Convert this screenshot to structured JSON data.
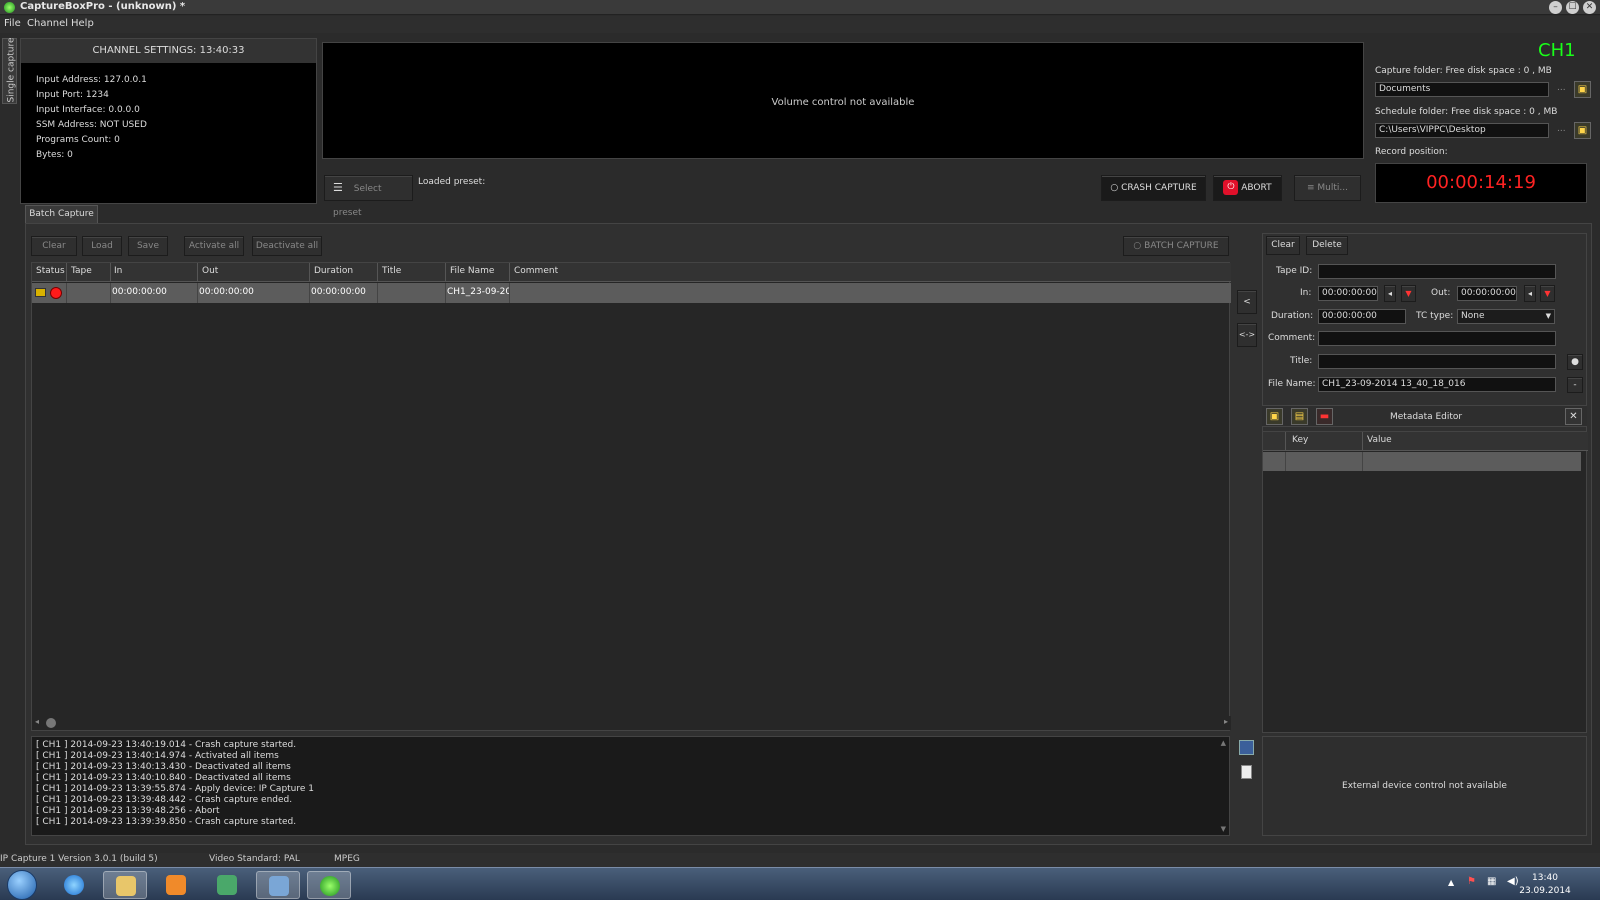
{
  "window": {
    "title": "CaptureBoxPro - (unknown) *",
    "min": "–",
    "max": "☐",
    "close": "✕"
  },
  "menu": [
    "File",
    "Channel",
    "Help"
  ],
  "sidetab": "Single capture",
  "channel_settings": {
    "title": "CHANNEL SETTINGS: 13:40:33",
    "lines": [
      "Input Address: 127.0.0.1",
      "Input Port: 1234",
      "Input Interface: 0.0.0.0",
      "SSM Address: NOT USED",
      "Programs Count: 0",
      "Bytes: 0"
    ]
  },
  "video": {
    "message": "Volume control not available"
  },
  "preset": {
    "select": "Select preset",
    "loaded": "Loaded preset:"
  },
  "controls": {
    "crash": "CRASH CAPTURE",
    "abort": "ABORT",
    "multi": "Multi..."
  },
  "channel": {
    "name": "CH1"
  },
  "capture_folder": {
    "label": "Capture folder:  Free disk space : 0 , MB",
    "value": "Documents",
    "more": "..."
  },
  "schedule_folder": {
    "label": "Schedule folder:  Free disk space : 0 , MB",
    "value": "C:\\Users\\VIPPC\\Desktop",
    "more": "..."
  },
  "record_position": {
    "label": "Record position:",
    "value": "00:00:14:19"
  },
  "batch_tab": "Batch Capture",
  "batch_toolbar": {
    "clear": "Clear",
    "load": "Load",
    "save": "Save",
    "activate_all": "Activate all",
    "deactivate_all": "Deactivate all",
    "batch_capture": "BATCH CAPTURE"
  },
  "grid": {
    "columns": [
      "Status",
      "Tape",
      "In",
      "Out",
      "Duration",
      "Title",
      "File Name",
      "Comment"
    ],
    "rows": [
      {
        "tape": "",
        "in": "00:00:00:00",
        "out": "00:00:00:00",
        "duration": "00:00:00:00",
        "title": "",
        "file_name": "CH1_23-09-201",
        "comment": ""
      }
    ]
  },
  "mid_buttons": {
    "left": "<",
    "both": "<->"
  },
  "editor": {
    "clear": "Clear",
    "delete": "Delete",
    "tape_id_label": "Tape ID:",
    "tape_id": "",
    "in_label": "In:",
    "in": "00:00:00:00",
    "out_label": "Out:",
    "out": "00:00:00:00",
    "duration_label": "Duration:",
    "duration": "00:00:00:00",
    "tc_type_label": "TC type:",
    "tc_type": "None",
    "comment_label": "Comment:",
    "comment": "",
    "title_label": "Title:",
    "title": "",
    "file_name_label": "File Name:",
    "file_name": "CH1_23-09-2014 13_40_18_016",
    "metadata_title": "Metadata Editor",
    "meta_columns": [
      "Key",
      "Value"
    ]
  },
  "log": [
    "[ CH1 ] 2014-09-23 13:40:19.014 - Crash capture started.",
    "[ CH1 ] 2014-09-23 13:40:14.974 - Activated all items",
    "[ CH1 ] 2014-09-23 13:40:13.430 - Deactivated all items",
    "[ CH1 ] 2014-09-23 13:40:10.840 - Deactivated all items",
    "[ CH1 ] 2014-09-23 13:39:55.874 - Apply device: IP Capture 1",
    "[ CH1 ] 2014-09-23 13:39:48.442 - Crash capture ended.",
    "[ CH1 ] 2014-09-23 13:39:48.256 - Abort",
    "[ CH1 ] 2014-09-23 13:39:39.850 - Crash capture started."
  ],
  "external_device": "External device control not available",
  "status": {
    "device": "IP Capture 1  Version 3.0.1 (build 5)",
    "standard": "Video Standard: PAL",
    "format": "MPEG"
  },
  "clock": {
    "time": "13:40",
    "date": "23.09.2014"
  },
  "colors": {
    "accent_green": "#19ff19",
    "record_red": "#ff2222",
    "abort_red": "#e0102a"
  }
}
